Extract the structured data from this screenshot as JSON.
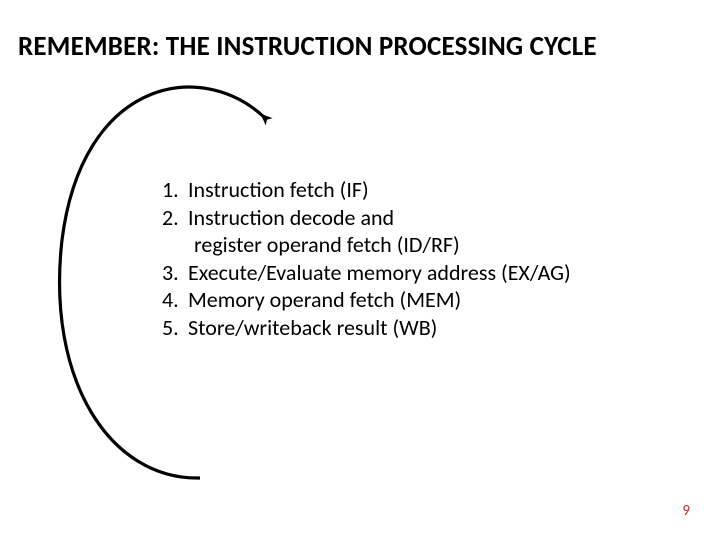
{
  "title": "REMEMBER: THE INSTRUCTION PROCESSING CYCLE",
  "steps": {
    "s1_num": "1.",
    "s1_text": "Instruction fetch (IF)",
    "s2_num": "2.",
    "s2_text": "Instruction decode and",
    "s2b_text": "register operand fetch (ID/RF)",
    "s3_num": "3.",
    "s3_text": "Execute/Evaluate memory address (EX/AG)",
    "s4_num": "4.",
    "s4_text": "Memory operand fetch (MEM)",
    "s5_num": "5.",
    "s5_text": "Store/writeback result (WB)"
  },
  "page_number": "9"
}
